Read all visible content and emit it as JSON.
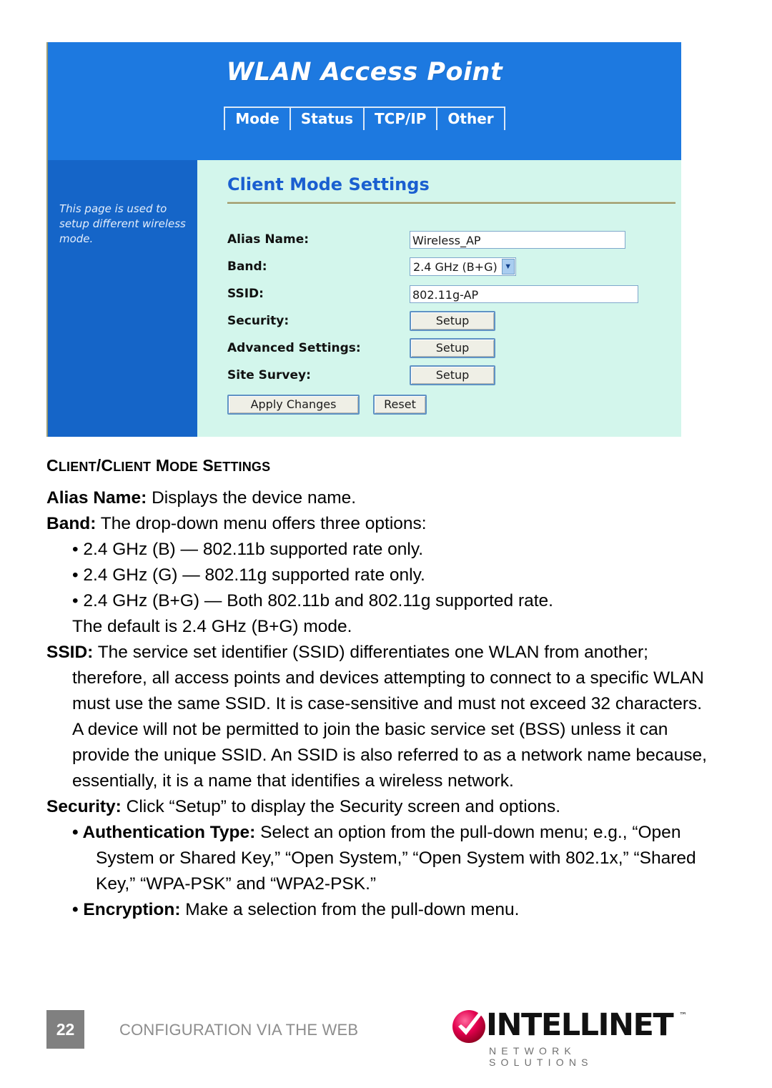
{
  "screenshot": {
    "title": "WLAN Access Point",
    "tabs": [
      {
        "label": "Mode"
      },
      {
        "label": "Status"
      },
      {
        "label": "TCP/IP"
      },
      {
        "label": "Other"
      }
    ],
    "sidebar_help": "This page is used to setup different wireless mode.",
    "panel_title": "Client Mode Settings",
    "fields": {
      "alias_label": "Alias Name:",
      "alias_value": "Wireless_AP",
      "band_label": "Band:",
      "band_value": "2.4 GHz (B+G)",
      "ssid_label": "SSID:",
      "ssid_value": "802.11g-AP",
      "security_label": "Security:",
      "security_button": "Setup",
      "advanced_label": "Advanced Settings:",
      "advanced_button": "Setup",
      "sitesurvey_label": "Site Survey:",
      "sitesurvey_button": "Setup"
    },
    "actions": {
      "apply": "Apply Changes",
      "reset": "Reset"
    },
    "colors": {
      "header_blue": "#1d79e0",
      "sidebar_blue": "#1565c8",
      "panel_mint": "#d3f6ec",
      "panel_title_blue": "#1a5fd0",
      "rule_olive": "#9e9868"
    }
  },
  "article": {
    "heading_parts": {
      "c1": "C",
      "lient1": "LIENT",
      "slash": "/",
      "c2": "C",
      "lient2": "LIENT",
      "m": "M",
      "ode": "ODE",
      "s": "S",
      "ettings": "ETTINGS"
    },
    "alias": {
      "term": "Alias Name:",
      "text": " Displays the device name."
    },
    "band": {
      "term": "Band:",
      "text": " The drop-down menu offers three options:",
      "bullets": [
        "• 2.4 GHz (B) — 802.11b supported rate only.",
        "• 2.4 GHz (G) — 802.11g supported rate only.",
        "• 2.4 GHz (B+G) — Both 802.11b and 802.11g supported rate."
      ],
      "default_note": "The default is 2.4 GHz (B+G) mode."
    },
    "ssid": {
      "term": "SSID:",
      "text": " The service set identifier (SSID) differentiates one WLAN from another; therefore, all access points and devices attempting to connect to a specific WLAN must use the same SSID. It is case-sensitive and must not exceed 32 characters. A device will not be permitted to join the basic service set (BSS) unless it can provide the unique SSID. An SSID is also referred to as a network name because, essentially, it is a name that identifies a wireless network."
    },
    "security": {
      "term": "Security:",
      "text": " Click “Setup” to display the Security screen and options.",
      "auth_term": "• Authentication Type:",
      "auth_text": " Select an option from the pull-down menu; e.g., “Open System or Shared Key,” “Open System,” “Open System with 802.1x,” “Shared Key,” “WPA-PSK” and “WPA2-PSK.”",
      "enc_term": "• Encryption:",
      "enc_text": " Make a selection from the pull-down menu."
    }
  },
  "footer": {
    "page_number": "22",
    "section_label": "CONFIGURATION VIA THE WEB",
    "brand_name": "INTELLINET",
    "brand_tm": "™",
    "brand_tagline": "NETWORK SOLUTIONS",
    "brand_colors": {
      "mark_red": "#e2004e",
      "page_box_gray": "#808080"
    }
  }
}
